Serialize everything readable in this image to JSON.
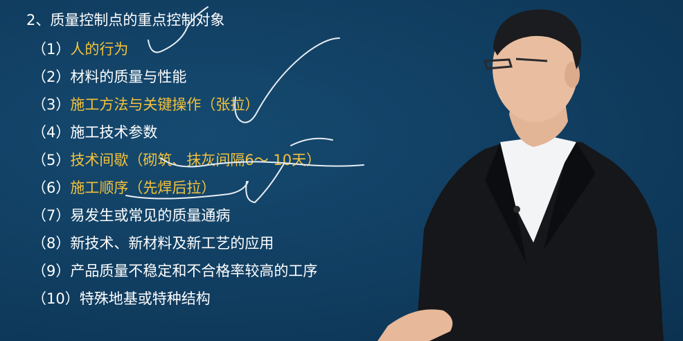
{
  "slide": {
    "title": "2、质量控制点的重点控制对象",
    "items": [
      {
        "num": "（1）",
        "text": "人的行为",
        "highlight": true
      },
      {
        "num": "（2）",
        "text": "材料的质量与性能",
        "highlight": false
      },
      {
        "num": "（3）",
        "text": "施工方法与关键操作（张拉）",
        "highlight": true
      },
      {
        "num": "（4）",
        "text": "施工技术参数",
        "highlight": false
      },
      {
        "num": "（5）",
        "text": "技术间歇（砌筑、抹灰间隔6～ 10天）",
        "highlight": true
      },
      {
        "num": "（6）",
        "text": "施工顺序（先焊后拉）",
        "highlight": true
      },
      {
        "num": "（7）",
        "text": "易发生或常见的质量通病",
        "highlight": false
      },
      {
        "num": "（8）",
        "text": "新技术、新材料及新工艺的应用",
        "highlight": false
      },
      {
        "num": "（9）",
        "text": "产品质量不稳定和不合格率较高的工序",
        "highlight": false
      },
      {
        "num": "（10）",
        "text": "特殊地基或特种结构",
        "highlight": false
      }
    ]
  },
  "colors": {
    "background": "#103d60",
    "text": "#ffffff",
    "highlight_text": "#f3c23c",
    "ink": "#e8eef4"
  }
}
